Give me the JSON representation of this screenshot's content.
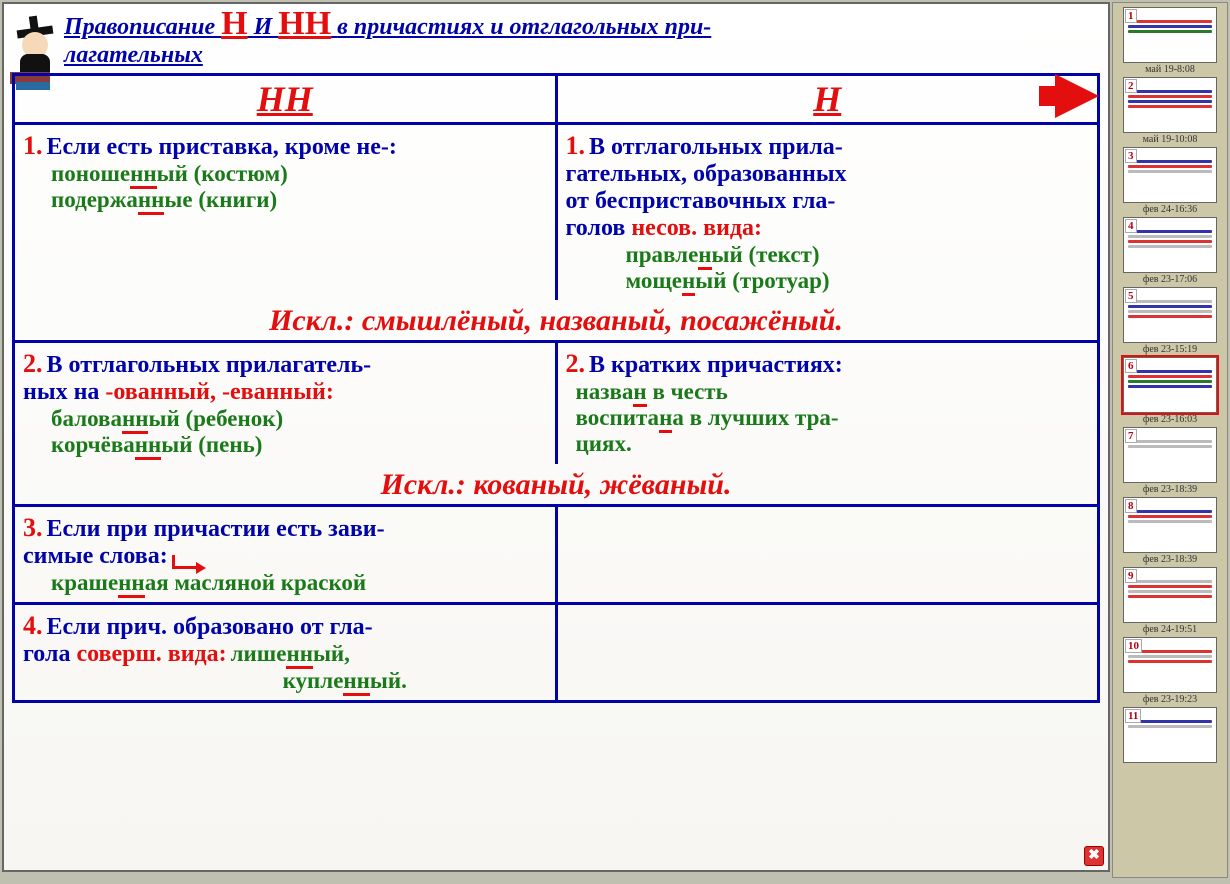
{
  "title": {
    "part1": "Правописание ",
    "h1": "Н",
    "mid": " И ",
    "h2": "НН",
    "part2": " в причастиях и отглагольных при-",
    "part3": "лагательных"
  },
  "headers": {
    "nn": "НН",
    "n": "Н"
  },
  "chart_data": {
    "type": "table",
    "title": "Правописание Н и НН в причастиях и отглагольных прилагательных",
    "columns": [
      "НН",
      "Н"
    ],
    "rows": [
      {
        "НН": {
          "rule": "Если есть приставка, кроме не-:",
          "examples": [
            "поношенный (костюм)",
            "подержанные (книги)"
          ]
        },
        "Н": {
          "rule": "В отглагольных прилагательных, образованных от бесприставочных глаголов несов. вида:",
          "examples": [
            "правленый (текст)",
            "мощеный (тротуар)"
          ]
        },
        "exception": "Искл.: смышлёный, названый, посажёный."
      },
      {
        "НН": {
          "rule": "В отглагольных прилагательных на -ованный, -еванный:",
          "examples": [
            "балованный (ребенок)",
            "корчёванный (пень)"
          ]
        },
        "Н": {
          "rule": "В кратких причастиях:",
          "examples": [
            "назван в честь",
            "воспитана в лучших традициях."
          ]
        },
        "exception": "Искл.: кованый, жёваный."
      },
      {
        "НН": {
          "rule": "Если при причастии есть зависимые слова:",
          "examples": [
            "крашенная масляной краской"
          ]
        },
        "Н": null
      },
      {
        "НН": {
          "rule": "Если прич. образовано от глагола соверш. вида:",
          "examples": [
            "лишённый,",
            "купленный."
          ]
        },
        "Н": null
      }
    ]
  },
  "r1": {
    "left": {
      "num": "1.",
      "rule_a": "Если есть приставка, кроме не-:",
      "ex1_a": "поноше",
      "ex1_u": "нн",
      "ex1_b": "ый (костюм)",
      "ex2_a": "подержа",
      "ex2_u": "нн",
      "ex2_b": "ые (книги)"
    },
    "right": {
      "num": "1.",
      "rule_a": "В отглагольных прила-",
      "rule_b": "гательных, образованных",
      "rule_c": "от бесприставочных гла-",
      "rule_d": "голов ",
      "rule_e": "несов. вида:",
      "ex1_a": "правле",
      "ex1_u": "н",
      "ex1_b": "ый (текст)",
      "ex2_a": "моще",
      "ex2_u": "н",
      "ex2_b": "ый (тротуар)"
    },
    "excl": "Искл.: смышлёный, названый, посажёный."
  },
  "r2": {
    "left": {
      "num": "2.",
      "rule_a": "В отглагольных прилагатель-",
      "rule_b": "ных на ",
      "rule_c": "-ованный, -еванный:",
      "ex1_a": "балова",
      "ex1_u": "нн",
      "ex1_b": "ый (ребенок)",
      "ex2_a": "корчёва",
      "ex2_u": "нн",
      "ex2_b": "ый (пень)"
    },
    "right": {
      "num": "2.",
      "rule_a": "В кратких причастиях:",
      "ex1_a": "назва",
      "ex1_u": "н",
      "ex1_b": " в честь",
      "ex2_a": "воспита",
      "ex2_u": "н",
      "ex2_b": "а в лучших тра-",
      "ex2_c": "циях."
    },
    "excl": "Искл.: кованый, жёваный."
  },
  "r3": {
    "left": {
      "num": "3.",
      "rule_a": "Если при причастии есть зави-",
      "rule_b": "симые слова:",
      "ex1_a": "краше",
      "ex1_u": "нн",
      "ex1_b": "ая масляной краской"
    }
  },
  "r4": {
    "left": {
      "num": "4.",
      "rule_a": "Если прич. образовано от гла-",
      "rule_b": "гола ",
      "rule_c": "соверш. вида:",
      "ex1_a": " лише",
      "ex1_u": "нн",
      "ex1_b": "ый,",
      "ex2_a": "купле",
      "ex2_u": "нн",
      "ex2_b": "ый."
    }
  },
  "close_x": "✖",
  "thumbs": [
    {
      "num": "1",
      "label": "май 19-8:08",
      "active": false
    },
    {
      "num": "2",
      "label": "май 19-10:08",
      "active": false
    },
    {
      "num": "3",
      "label": "фев 24-16:36",
      "active": false
    },
    {
      "num": "4",
      "label": "фев 23-17:06",
      "active": false
    },
    {
      "num": "5",
      "label": "фев 23-15:19",
      "active": false
    },
    {
      "num": "6",
      "label": "фев 23-16:03",
      "active": true
    },
    {
      "num": "7",
      "label": "фев 23-18:39",
      "active": false
    },
    {
      "num": "8",
      "label": "фев 23-18:39",
      "active": false
    },
    {
      "num": "9",
      "label": "фев 24-19:51",
      "active": false
    },
    {
      "num": "10",
      "label": "фев 23-19:23",
      "active": false
    },
    {
      "num": "11",
      "label": "",
      "active": false
    }
  ]
}
